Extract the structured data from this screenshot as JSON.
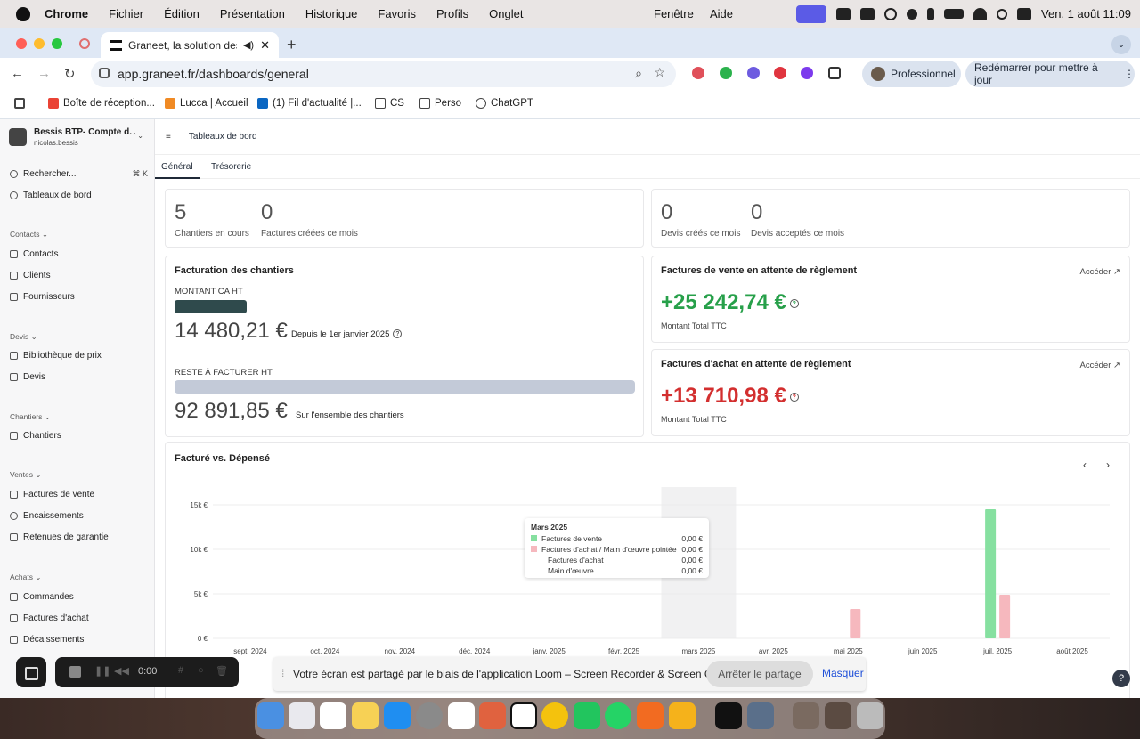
{
  "menubar": {
    "app_name": "Chrome",
    "items": [
      "Fichier",
      "Édition",
      "Présentation",
      "Historique",
      "Favoris",
      "Profils",
      "Onglet"
    ],
    "right_items": [
      "Fenêtre",
      "Aide"
    ],
    "datetime": "Ven. 1 août  11:09"
  },
  "browser": {
    "tab_title": "Graneet, la solution des m",
    "url": "app.graneet.fr/dashboards/general",
    "profile": "Professionnel",
    "restart": "Redémarrer pour mettre à jour",
    "bookmarks": [
      "Boîte de réception...",
      "Lucca | Accueil",
      "(1) Fil d'actualité |...",
      "CS",
      "Perso",
      "ChatGPT"
    ]
  },
  "sidebar": {
    "company": "Bessis BTP- Compte d...",
    "user": "nicolas.bessis",
    "search": "Rechercher...",
    "search_shortcut": "⌘ K",
    "dashboards": "Tableaux de bord",
    "sections": [
      {
        "title": "Contacts",
        "items": [
          "Contacts",
          "Clients",
          "Fournisseurs"
        ]
      },
      {
        "title": "Devis",
        "items": [
          "Bibliothèque de prix",
          "Devis"
        ]
      },
      {
        "title": "Chantiers",
        "items": [
          "Chantiers"
        ]
      },
      {
        "title": "Ventes",
        "items": [
          "Factures de vente",
          "Encaissements",
          "Retenues de garantie"
        ]
      },
      {
        "title": "Achats",
        "items": [
          "Commandes",
          "Factures d'achat",
          "Décaissements"
        ]
      }
    ]
  },
  "page": {
    "breadcrumb": "Tableaux de bord",
    "tabs": [
      "Général",
      "Trésorerie"
    ],
    "stats_left": [
      {
        "value": "5",
        "label": "Chantiers en cours"
      },
      {
        "value": "0",
        "label": "Factures créées ce mois"
      }
    ],
    "stats_right": [
      {
        "value": "0",
        "label": "Devis créés ce mois"
      },
      {
        "value": "0",
        "label": "Devis acceptés ce mois"
      }
    ],
    "billing": {
      "title": "Facturation des chantiers",
      "ca_label": "MONTANT CA HT",
      "ca_value": "14 480,21 €",
      "ca_note": "Depuis le 1er janvier 2025",
      "rest_label": "RESTE À FACTURER HT",
      "rest_value": "92 891,85 €",
      "rest_note": "Sur l'ensemble des chantiers"
    },
    "sales_pending": {
      "title": "Factures de vente en attente de règlement",
      "access": "Accéder",
      "value": "+25 242,74 €",
      "sub": "Montant Total TTC"
    },
    "purchase_pending": {
      "title": "Factures d'achat en attente de règlement",
      "access": "Accéder",
      "value": "+13 710,98 €",
      "sub": "Montant Total TTC"
    }
  },
  "chart_data": {
    "type": "bar",
    "title": "Facturé vs. Dépensé",
    "categories": [
      "sept. 2024",
      "oct. 2024",
      "nov. 2024",
      "déc. 2024",
      "janv. 2025",
      "févr. 2025",
      "mars 2025",
      "avr. 2025",
      "mai 2025",
      "juin 2025",
      "juil. 2025",
      "août 2025"
    ],
    "series": [
      {
        "name": "Factures de vente",
        "values": [
          0,
          0,
          0,
          0,
          0,
          0,
          0,
          0,
          0,
          0,
          14500,
          0
        ],
        "color": "#86e0a0"
      },
      {
        "name": "Factures d'achat / Main d'œuvre pointée",
        "values": [
          0,
          0,
          0,
          0,
          0,
          0,
          0,
          0,
          3300,
          0,
          4900,
          0
        ],
        "color": "#f6b8be"
      }
    ],
    "y_ticks": [
      "0 €",
      "5k €",
      "10k €",
      "15k €"
    ],
    "ylim": [
      0,
      17000
    ],
    "grid": true,
    "highlight_category": "mars 2025",
    "tooltip": {
      "title": "Mars 2025",
      "rows": [
        {
          "label": "Factures de vente",
          "value": "0,00 €"
        },
        {
          "label": "Factures d'achat / Main d'œuvre pointée",
          "value": "0,00 €"
        },
        {
          "label": "Factures d'achat",
          "value": "0,00 €"
        },
        {
          "label": "Main d'œuvre",
          "value": "0,00 €"
        }
      ]
    }
  },
  "loom": {
    "timer": "0:00",
    "message": "Votre écran est partagé par le biais de l'application Loom – Screen Recorder & Screen Capture.",
    "stop": "Arrêter le partage",
    "hide": "Masquer"
  },
  "help": "?"
}
